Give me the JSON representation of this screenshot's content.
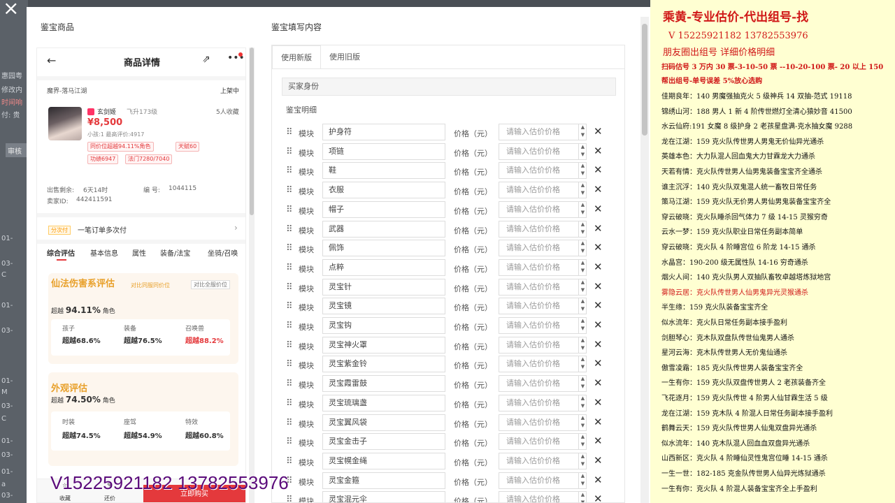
{
  "background": {
    "texts": [
      "惠园粤",
      "修改内",
      "时间响",
      "付: 贵",
      "审核",
      "01-",
      "03-",
      "C",
      "01-",
      "03-",
      "01-",
      "M",
      "03-",
      "C",
      "01-",
      "03-",
      "01-",
      "a",
      "03-"
    ]
  },
  "modal": {
    "left_title": "鉴宝商品",
    "right_title": "鉴宝填写内容"
  },
  "product": {
    "title": "商品详情",
    "server": "魔界-落马江湖",
    "listed": "上架中",
    "char_name": "玄剑姬",
    "char_level": "飞升173级",
    "favorites": "5人收藏",
    "price": "¥8,500",
    "sub_info": "小孩:1 最高评价:4917",
    "tags": [
      "同价位超越94.11%角色",
      "天赋60",
      "功绩6947",
      "法门7280/7040"
    ],
    "sale_time_label": "出售剩余:",
    "sale_time": "6天14时",
    "id_label": "编 号:",
    "id_value": "1044115",
    "seller_label": "卖家ID:",
    "seller_id": "442411591",
    "installment_tag": "分次付",
    "installment_text": "一笔订单多次付",
    "tabs": [
      "综合评估",
      "基本信息",
      "属性",
      "装备/法宝",
      "坐骑/召唤"
    ],
    "card1": {
      "title": "仙法伤害系评估",
      "hint1": "对比同服同价位",
      "hint2": "对比全服价位",
      "pct_prefix": "超越",
      "pct": "94.11%",
      "pct_suffix": "角色",
      "stats": [
        {
          "label": "孩子",
          "value": "超越68.6%"
        },
        {
          "label": "装备",
          "value": "超越76.5%"
        },
        {
          "label": "召唤兽",
          "value": "超越88.2%"
        }
      ]
    },
    "card2": {
      "title": "外观评估",
      "pct_prefix": "超越",
      "pct": "74.50%",
      "pct_suffix": "角色",
      "stats": [
        {
          "label": "时装",
          "value": "超越74.5%"
        },
        {
          "label": "座驾",
          "value": "超越54.9%"
        },
        {
          "label": "特效",
          "value": "超越60.8%"
        }
      ]
    },
    "bottom": {
      "fav": "收藏",
      "bargain": "还价",
      "buy": "立即购买"
    }
  },
  "form": {
    "tabs": [
      "使用新版",
      "使用旧版"
    ],
    "buyer_section": "买家身份",
    "detail_label": "鉴宝明细",
    "module_label": "模块",
    "price_label": "价格（元）",
    "price_placeholder": "请输入估价价格",
    "items": [
      "护身符",
      "项链",
      "鞋",
      "衣服",
      "帽子",
      "武器",
      "佩饰",
      "点粹",
      "灵宝针",
      "灵宝镜",
      "灵宝钩",
      "灵宝神火罩",
      "灵宝紫金铃",
      "灵宝霞雷鼓",
      "灵宝琉璃盏",
      "灵宝翼风袋",
      "灵宝金击子",
      "灵宝幌金绳",
      "灵宝金箍",
      "灵宝混元伞"
    ]
  },
  "watermark": "V15225921182  13782553976",
  "ad": {
    "title": "乘黄-专业估价-代出组号-找",
    "phone": "V 15225921182   13782553976",
    "line3": "朋友圈出组号    详细价格明细",
    "line4": "扫码估号 3 万内 30 票-3-10-50 票 --10-20-100 票- 20 以上 150",
    "line5": "帮出组号-单号误差 5%放心选购",
    "entries": [
      {
        "text": "佳期良年：140 男魔强抽克火 5 级神兵 14 双抽-范式 19118",
        "red": false
      },
      {
        "text": "锦绣山河：188 男人 1 新 4 阶传世燃灯全清心猿妙音 41500",
        "red": false
      },
      {
        "text": "水云仙府:191 女魔 8 级护身 2 老孩星盘满-克水抽女魔 9288",
        "red": false
      },
      {
        "text": "龙在江湖：159 克火队传世男人男鬼无价仙异光通杀",
        "red": false
      },
      {
        "text": "英雄本色：大力队混人回血鬼大力甘霖龙大力通杀",
        "red": false
      },
      {
        "text": "天若有情：克火队传世男人仙男鬼装备宝宝齐全通杀",
        "red": false
      },
      {
        "text": "谁主沉浮：140 克火队双鬼混人统一畜牧日常任务",
        "red": false
      },
      {
        "text": "策马江湖：159 克火队无价男人男仙男鬼装备宝宝齐全",
        "red": false
      },
      {
        "text": "穿云破晓：克火队睡杀回气体力 7 级 14-15 灵猴穷奇",
        "red": false
      },
      {
        "text": "云水一梦：159 克火队职业日常任务副本简单",
        "red": false
      },
      {
        "text": "穿云破晓：克火队 4 阶睡宫位 6 阶龙 14-15 通杀",
        "red": false
      },
      {
        "text": "水晶宫：190-200 级无属性队 14-16 穷奇通杀",
        "red": false
      },
      {
        "text": "烟火人间：140 克火队男人双抽队畜牧卓越塔炼狱地宫",
        "red": false
      },
      {
        "text": "雾隐云居：克火队传世男人仙男鬼异光灵猴通杀",
        "red": true
      },
      {
        "text": "半生缘：159 克火队装备宝宝齐全",
        "red": false
      },
      {
        "text": "似水流年：克火队日常任务副本接手盈利",
        "red": false
      },
      {
        "text": "剑胆琴心：克木队双盘队传世仙鬼男人通杀",
        "red": false
      },
      {
        "text": "星河云海：克木队传世男人无价鬼仙通杀",
        "red": false
      },
      {
        "text": "傲雪凌霜：185 克火队传世男人装备宝宝齐全",
        "red": false
      },
      {
        "text": "一生有你：159 克火队双盘传世男人 2 老孩装备齐全",
        "red": false
      },
      {
        "text": "飞花逐月：159 克火队传世 4 阶男人仙甘霖生活 5 级",
        "red": false
      },
      {
        "text": "龙在江湖：159 克木队 4 阶混人日常任务副本接手盈利",
        "red": false
      },
      {
        "text": "鹤舞云天：159 克火队传世男人仙鬼双盘异光通杀",
        "red": false
      },
      {
        "text": "似水流年：140 克木队混人回血血双盘异光通杀",
        "red": false
      },
      {
        "text": "山西新区：克火队 4 阶睡仙灵性鬼宫位睡 14-15 通杀",
        "red": false
      },
      {
        "text": "一生一世：182-185 克金队传世男人仙异光炼狱通杀",
        "red": false
      },
      {
        "text": "一生有你：克火队 4 阶混人装备宝宝齐全上手盈利",
        "red": false
      }
    ]
  }
}
